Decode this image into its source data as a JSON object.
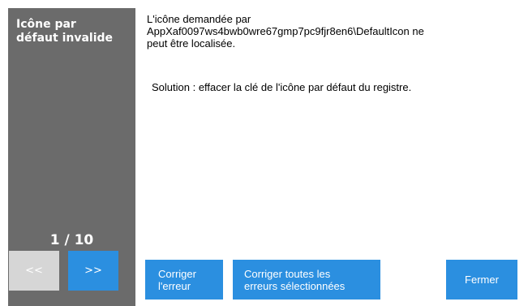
{
  "sidebar": {
    "title_line1": "Icône par",
    "title_line2": "défaut invalide",
    "counter": "1 / 10",
    "prev_label": "<<",
    "next_label": ">>"
  },
  "message": {
    "line1": "L'icône demandée par",
    "line2": "AppXaf0097ws4bwb0wre67gmp7pc9fjr8en6\\DefaultIcon ne",
    "line3": "peut être localisée.",
    "solution": "Solution : effacer la clé de l'icône par défaut du registre."
  },
  "actions": {
    "fix_line1": "Corriger",
    "fix_line2": "l'erreur",
    "fix_all_line1": "Corriger toutes les",
    "fix_all_line2": "erreurs sélectionnées",
    "close_label": "Fermer"
  },
  "colors": {
    "sidebar_bg": "#6b6b6b",
    "accent": "#2b8fe0",
    "disabled": "#d6d6d6"
  }
}
